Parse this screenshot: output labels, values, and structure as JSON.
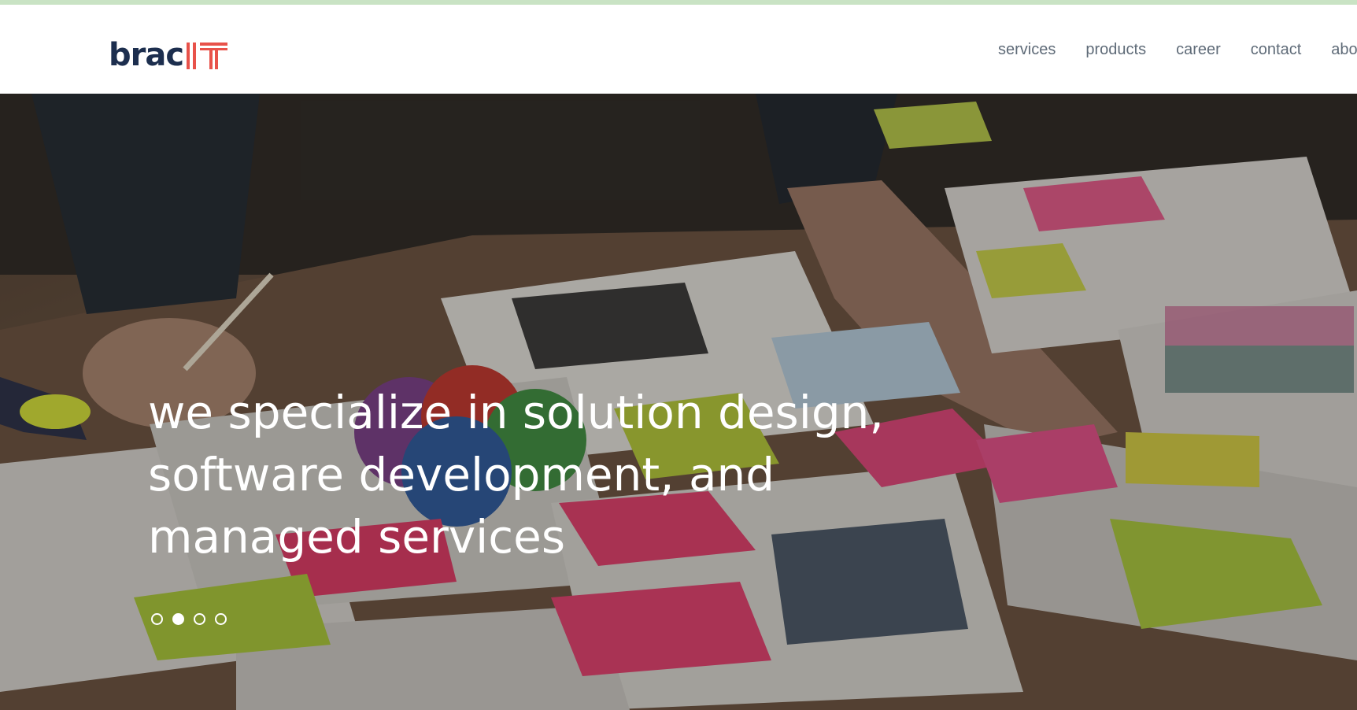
{
  "brand": {
    "word": "brac",
    "mark": "IT",
    "colors": {
      "dark": "#1c2e4e",
      "accent": "#e8524a"
    }
  },
  "nav": {
    "items": [
      {
        "label": "services"
      },
      {
        "label": "products"
      },
      {
        "label": "career"
      },
      {
        "label": "contact"
      },
      {
        "label": "about"
      }
    ]
  },
  "hero": {
    "headline_lines": [
      "we specialize in solution design,",
      "software development, and",
      "managed services"
    ],
    "carousel": {
      "total": 4,
      "active_index": 1
    }
  }
}
